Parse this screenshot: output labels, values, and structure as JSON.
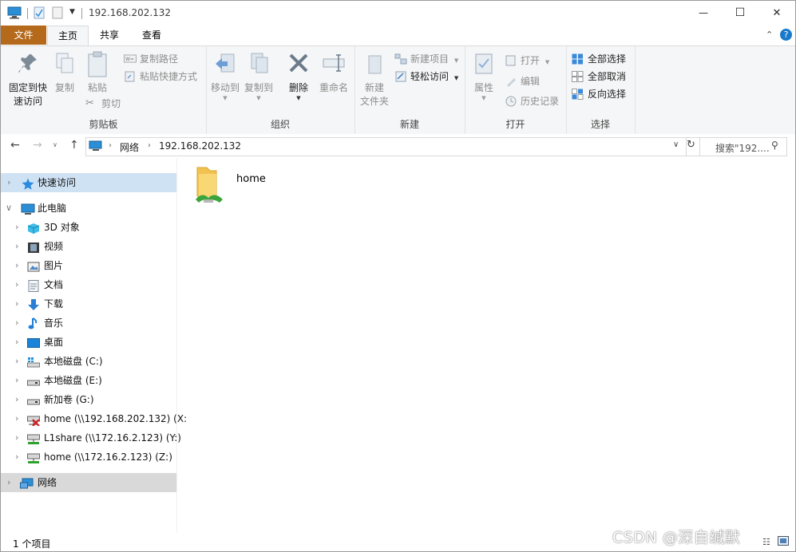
{
  "window": {
    "title": "192.168.202.132",
    "controls": {
      "minimize": "—",
      "maximize": "☐",
      "close": "✕"
    }
  },
  "ribbon_tabs": [
    {
      "label": "文件"
    },
    {
      "label": "主页"
    },
    {
      "label": "共享"
    },
    {
      "label": "查看"
    }
  ],
  "ribbon": {
    "clipboard": {
      "group_label": "剪贴板",
      "pin_line1": "固定到快",
      "pin_line2": "速访问",
      "copy": "复制",
      "paste": "粘贴",
      "copy_path": "复制路径",
      "paste_shortcut": "粘贴快捷方式",
      "cut": "剪切"
    },
    "organize": {
      "group_label": "组织",
      "move_to": "移动到",
      "copy_to": "复制到",
      "delete": "删除",
      "rename": "重命名"
    },
    "new": {
      "group_label": "新建",
      "new_folder_line1": "新建",
      "new_folder_line2": "文件夹",
      "new_item": "新建项目",
      "easy_access": "轻松访问"
    },
    "open": {
      "group_label": "打开",
      "properties": "属性",
      "open": "打开",
      "edit": "编辑",
      "history": "历史记录"
    },
    "select": {
      "group_label": "选择",
      "select_all": "全部选择",
      "select_none": "全部取消",
      "invert": "反向选择"
    }
  },
  "address": {
    "crumbs": [
      "网络",
      "192.168.202.132"
    ],
    "search_placeholder": "搜索\"192...."
  },
  "nav_pane": {
    "quick_access": "快速访问",
    "this_pc": "此电脑",
    "items": [
      {
        "label": "3D 对象",
        "icon": "cube-icon"
      },
      {
        "label": "视频",
        "icon": "video-icon"
      },
      {
        "label": "图片",
        "icon": "pictures-icon"
      },
      {
        "label": "文档",
        "icon": "documents-icon"
      },
      {
        "label": "下载",
        "icon": "download-icon"
      },
      {
        "label": "音乐",
        "icon": "music-icon"
      },
      {
        "label": "桌面",
        "icon": "desktop-icon"
      },
      {
        "label": "本地磁盘 (C:)",
        "icon": "windows-drive-icon"
      },
      {
        "label": "本地磁盘 (E:)",
        "icon": "drive-icon"
      },
      {
        "label": "新加卷 (G:)",
        "icon": "drive-icon"
      },
      {
        "label": "home (\\\\192.168.202.132) (X:",
        "icon": "network-drive-disconnected-icon"
      },
      {
        "label": "L1share (\\\\172.16.2.123) (Y:)",
        "icon": "network-drive-icon"
      },
      {
        "label": "home (\\\\172.16.2.123) (Z:)",
        "icon": "network-drive-icon"
      }
    ],
    "network": "网络"
  },
  "content": {
    "items": [
      {
        "label": "home",
        "icon": "shared-folder-icon"
      }
    ]
  },
  "status_bar": {
    "count": "1 个项目"
  },
  "watermark": "CSDN @深自缄默",
  "colors": {
    "file_tab": "#b4691b",
    "selection": "#cfe2f4",
    "accent": "#1979ca"
  }
}
